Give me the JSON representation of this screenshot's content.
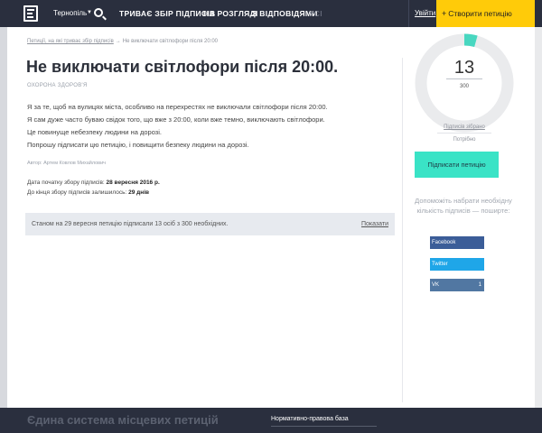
{
  "header": {
    "city": "Тернопіль",
    "nav": [
      "ТРИВАЄ ЗБІР ПІДПИСІВ",
      "НА РОЗГЛЯДІ",
      "З ВІДПОВІДЯМИ",
      "УСІ"
    ],
    "login": "Увійти",
    "create": "Створити петицію"
  },
  "breadcrumb": {
    "link": "Петиції, на які триває збір підписів",
    "current": "Не виключати світлофори після 20:00"
  },
  "petition": {
    "title": "Не виключати світлофори після 20:00.",
    "category": "ОХОРОНА ЗДОРОВ'Я",
    "body": [
      "Я за те, щоб на вулицях міста, особливо на перехрестях не виключали світлофори після 20:00.",
      "Я сам дуже часто буваю свідок того, що вже з 20:00, коли вже темно, виключають світлофори.",
      "Це повинуще небезпеку людини на дорозі.",
      "Попрошу підписати цю петицію, і повищити безпеку людини на дорозі."
    ],
    "author": "Автор: Артем Ковлов Михайлович",
    "start_label": "Дата початку збору підписів:",
    "start_date": "28 вересня 2016 р.",
    "remaining_label": "До кінця збору підписів залишилось:",
    "remaining": "29 днів"
  },
  "status": {
    "text": "Станом на 29 вересня петицію підписали 13 осіб з 300 необхідних.",
    "show": "Показати"
  },
  "sidebar": {
    "count": "13",
    "total": "300",
    "signatures_label": "Підписів зібрано",
    "needed_label": "Потрібно",
    "sign_button": "Підписати петицію",
    "help": "Допоможіть набрати необхідну кількість підписів — поширте:",
    "share": [
      {
        "label": "Facebook",
        "count": ""
      },
      {
        "label": "Twitter",
        "count": ""
      },
      {
        "label": "VK",
        "count": "1"
      }
    ]
  },
  "progress": {
    "signed": 13,
    "needed": 300,
    "ring_color": "#48d7c0",
    "track_color": "#eaebed"
  },
  "footer": {
    "title": "Єдина система місцевих петицій",
    "link": "Нормативно-правова база"
  }
}
